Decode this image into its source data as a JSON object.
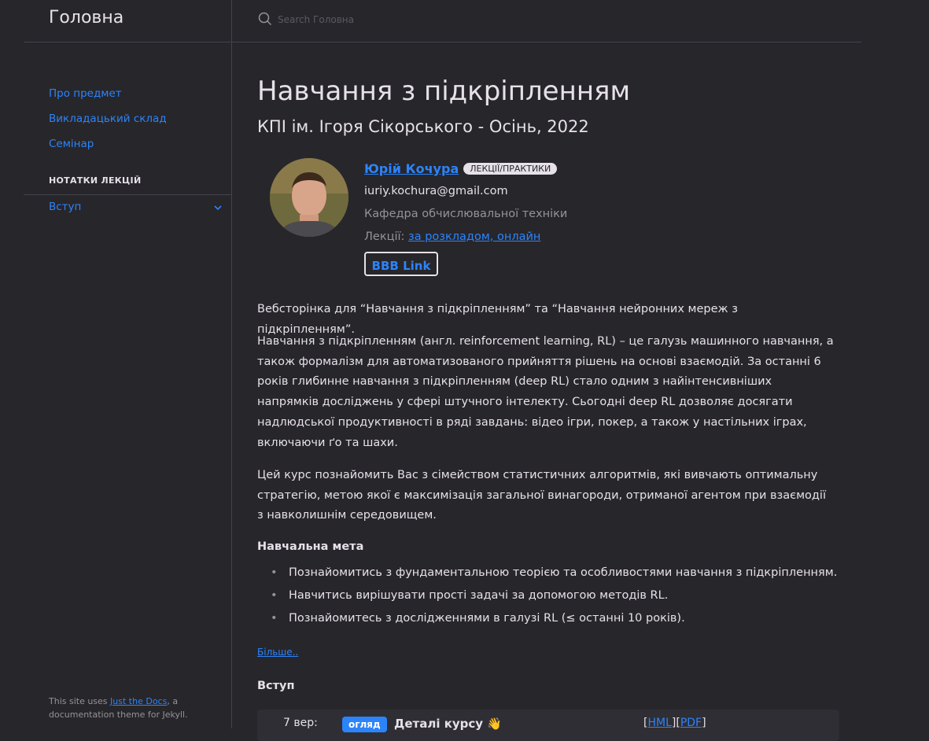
{
  "site": {
    "title": "Головна"
  },
  "search": {
    "placeholder": "Search Головна"
  },
  "nav": {
    "items": [
      {
        "label": "Про предмет"
      },
      {
        "label": "Викладацький склад"
      },
      {
        "label": "Семінар"
      }
    ],
    "section_label": "НОТАТКИ ЛЕКЦІЙ",
    "sub_item": {
      "label": "Вступ"
    }
  },
  "footer": {
    "prefix": "This site uses ",
    "link": "Just the Docs",
    "suffix": ", a documentation theme for Jekyll."
  },
  "page": {
    "title": "Навчання з підкріпленням",
    "subtitle": "КПІ ім. Ігоря Сікорського - Осінь, 2022"
  },
  "staff": {
    "name": "Юрій Кочура",
    "role": "ЛЕКЦІЇ/ПРАКТИКИ",
    "email": "iuriy.kochura@gmail.com",
    "department": "Кафедра обчислювальної техніки",
    "lectures_label": "Лекції:",
    "lectures_link": "за розкладом, онлайн",
    "button": "BBB Link"
  },
  "content": {
    "p1": "Вебсторінка для “Навчання з підкріпленням” та “Навчання нейронних мереж з підкріпленням”.",
    "p2": "Навчання з підкріпленням (англ. reinforcement learning, RL) – це галузь машинного навчання, а також формалізм для автоматизованого прийняття рішень на основі взаємодій. За останні 6 років глибинне навчання з підкріпленням (deep RL) стало одним з найінтенсивніших напрямків досліджень у сфері штучного інтелекту. Сьогодні deep RL дозволяє досягати надлюдської продуктивності в ряді завдань: відео ігри, покер, а також у настільних іграх, включаючи ґо та шахи.",
    "p3": "Цей курс познайомить Вас з сімейством статистичних алгоритмів, які вивчають оптимальну стратегію, метою якої є максимізація загальної винагороди, отриманої агентом при взаємодії з навколишнім середовищем.",
    "goal_title": "Навчальна мета",
    "goals": [
      "Познайомитись з фундаментальною теорією та особливостями навчання з підкріпленням.",
      "Навчитись вирішувати прості задачі за допомогою методів RL.",
      "Познайомитесь з дослідженнями в галузі RL (≤ останні 10 років)."
    ],
    "more": "Більше..",
    "section": "Вступ"
  },
  "schedule": {
    "date": "7 вер:",
    "badge": "огляд",
    "title": "Деталі курсу",
    "emoji": "👋",
    "link_html": "HML",
    "link_pdf": "PDF"
  }
}
